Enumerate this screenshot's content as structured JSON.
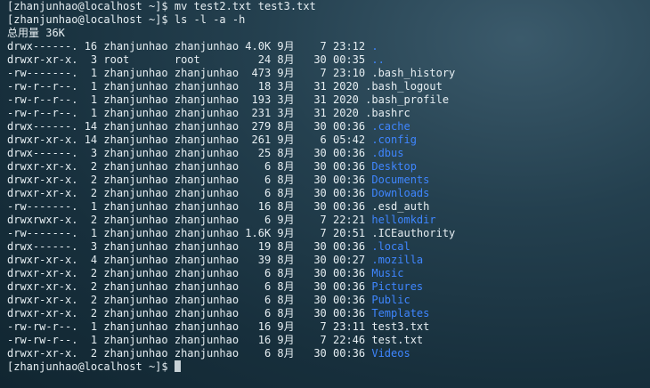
{
  "terminal": {
    "lines": [
      {
        "text": "[zhanjunhao@localhost ~]$ mv test2.txt test3.txt"
      },
      {
        "text": "[zhanjunhao@localhost ~]$ ls -l -a -h"
      },
      {
        "text": "总用量 36K"
      }
    ],
    "entries": [
      {
        "prefix": "drwx------. 16 zhanjunhao zhanjunhao 4.0K 9月    7 23:12 ",
        "name": ".",
        "type": "dir"
      },
      {
        "prefix": "drwxr-xr-x.  3 root       root         24 8月   30 00:35 ",
        "name": "..",
        "type": "dir"
      },
      {
        "prefix": "-rw-------.  1 zhanjunhao zhanjunhao  473 9月    7 23:10 ",
        "name": ".bash_history",
        "type": "file"
      },
      {
        "prefix": "-rw-r--r--.  1 zhanjunhao zhanjunhao   18 3月   31 2020 ",
        "name": ".bash_logout",
        "type": "file"
      },
      {
        "prefix": "-rw-r--r--.  1 zhanjunhao zhanjunhao  193 3月   31 2020 ",
        "name": ".bash_profile",
        "type": "file"
      },
      {
        "prefix": "-rw-r--r--.  1 zhanjunhao zhanjunhao  231 3月   31 2020 ",
        "name": ".bashrc",
        "type": "file"
      },
      {
        "prefix": "drwx------. 14 zhanjunhao zhanjunhao  279 8月   30 00:36 ",
        "name": ".cache",
        "type": "dir"
      },
      {
        "prefix": "drwxr-xr-x. 14 zhanjunhao zhanjunhao  261 9月    6 05:42 ",
        "name": ".config",
        "type": "dir"
      },
      {
        "prefix": "drwx------.  3 zhanjunhao zhanjunhao   25 8月   30 00:36 ",
        "name": ".dbus",
        "type": "dir"
      },
      {
        "prefix": "drwxr-xr-x.  2 zhanjunhao zhanjunhao    6 8月   30 00:36 ",
        "name": "Desktop",
        "type": "dir"
      },
      {
        "prefix": "drwxr-xr-x.  2 zhanjunhao zhanjunhao    6 8月   30 00:36 ",
        "name": "Documents",
        "type": "dir"
      },
      {
        "prefix": "drwxr-xr-x.  2 zhanjunhao zhanjunhao    6 8月   30 00:36 ",
        "name": "Downloads",
        "type": "dir"
      },
      {
        "prefix": "-rw-------.  1 zhanjunhao zhanjunhao   16 8月   30 00:36 ",
        "name": ".esd_auth",
        "type": "file"
      },
      {
        "prefix": "drwxrwxr-x.  2 zhanjunhao zhanjunhao    6 9月    7 22:21 ",
        "name": "hellomkdir",
        "type": "dir"
      },
      {
        "prefix": "-rw-------.  1 zhanjunhao zhanjunhao 1.6K 9月    7 20:51 ",
        "name": ".ICEauthority",
        "type": "file"
      },
      {
        "prefix": "drwx------.  3 zhanjunhao zhanjunhao   19 8月   30 00:36 ",
        "name": ".local",
        "type": "dir"
      },
      {
        "prefix": "drwxr-xr-x.  4 zhanjunhao zhanjunhao   39 8月   30 00:27 ",
        "name": ".mozilla",
        "type": "dir"
      },
      {
        "prefix": "drwxr-xr-x.  2 zhanjunhao zhanjunhao    6 8月   30 00:36 ",
        "name": "Music",
        "type": "dir"
      },
      {
        "prefix": "drwxr-xr-x.  2 zhanjunhao zhanjunhao    6 8月   30 00:36 ",
        "name": "Pictures",
        "type": "dir"
      },
      {
        "prefix": "drwxr-xr-x.  2 zhanjunhao zhanjunhao    6 8月   30 00:36 ",
        "name": "Public",
        "type": "dir"
      },
      {
        "prefix": "drwxr-xr-x.  2 zhanjunhao zhanjunhao    6 8月   30 00:36 ",
        "name": "Templates",
        "type": "dir"
      },
      {
        "prefix": "-rw-rw-r--.  1 zhanjunhao zhanjunhao   16 9月    7 23:11 ",
        "name": "test3.txt",
        "type": "file"
      },
      {
        "prefix": "-rw-rw-r--.  1 zhanjunhao zhanjunhao   16 9月    7 22:46 ",
        "name": "test.txt",
        "type": "file"
      },
      {
        "prefix": "drwxr-xr-x.  2 zhanjunhao zhanjunhao    6 8月   30 00:36 ",
        "name": "Videos",
        "type": "dir"
      }
    ],
    "prompt": "[zhanjunhao@localhost ~]$ ",
    "colors": {
      "directory": "#3f86ff",
      "text": "#e6eef2",
      "background": "#172f3c"
    }
  }
}
